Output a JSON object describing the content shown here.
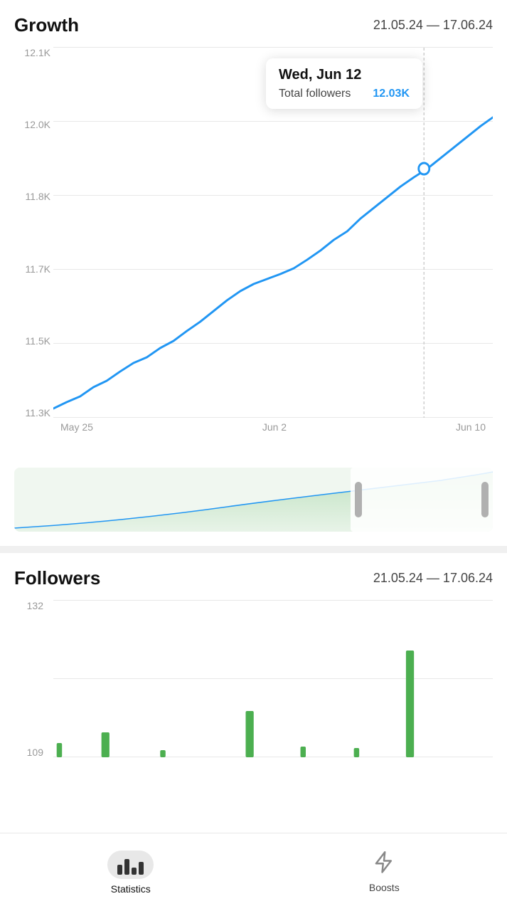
{
  "growth": {
    "title": "Growth",
    "date_range": "21.05.24 — 17.06.24",
    "y_labels": [
      "11.3K",
      "11.5K",
      "11.7K",
      "11.8K",
      "12.0K",
      "12.1K"
    ],
    "x_labels": [
      "May 25",
      "Jun 2",
      "Jun 10"
    ],
    "tooltip": {
      "date": "Wed, Jun 12",
      "label": "Total followers",
      "value": "12.03K"
    }
  },
  "followers": {
    "title": "Followers",
    "date_range": "21.05.24 — 17.06.24",
    "y_labels": [
      "109",
      "132"
    ]
  },
  "nav": {
    "statistics_label": "Statistics",
    "boosts_label": "Boosts"
  }
}
